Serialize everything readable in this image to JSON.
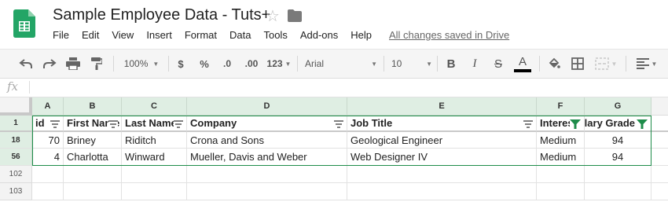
{
  "app": {
    "title": "Sample Employee Data - Tuts+",
    "saved_status": "All changes saved in Drive",
    "menu": [
      "File",
      "Edit",
      "View",
      "Insert",
      "Format",
      "Data",
      "Tools",
      "Add-ons",
      "Help"
    ]
  },
  "toolbar": {
    "zoom": "100%",
    "currency": "$",
    "percent": "%",
    "decrease_decimals": ".0",
    "increase_decimals": ".00",
    "more_formats": "123",
    "font": "Arial",
    "font_size": "10",
    "bold": "B",
    "italic": "I",
    "strikethrough": "S",
    "text_color": "A",
    "icons": [
      "undo-icon",
      "redo-icon",
      "print-icon",
      "paint-format-icon",
      "fill-color-icon",
      "borders-icon",
      "merge-cells-icon",
      "align-icon",
      "filter-icon"
    ]
  },
  "formula_bar": {
    "label": "fx",
    "value": ""
  },
  "grid": {
    "columns": [
      "A",
      "B",
      "C",
      "D",
      "E",
      "F",
      "G"
    ],
    "header_row_number": "1",
    "headers": [
      "id",
      "First Name",
      "Last Name",
      "Company",
      "Job Title",
      "Interest",
      "Salary Grade"
    ],
    "rows": [
      {
        "num": "18",
        "cells": [
          "70",
          "Briney",
          "Riditch",
          "Crona and Sons",
          "Geological Engineer",
          "Medium",
          "94"
        ]
      },
      {
        "num": "56",
        "cells": [
          "4",
          "Charlotta",
          "Winward",
          "Mueller, Davis and Weber",
          "Web Designer IV",
          "Medium",
          "94"
        ]
      }
    ],
    "empty_rows": [
      "102",
      "103"
    ]
  },
  "colors": {
    "accent": "#1e8c4a",
    "header_highlight": "#dfeee3",
    "sheets_green": "#23a566"
  }
}
